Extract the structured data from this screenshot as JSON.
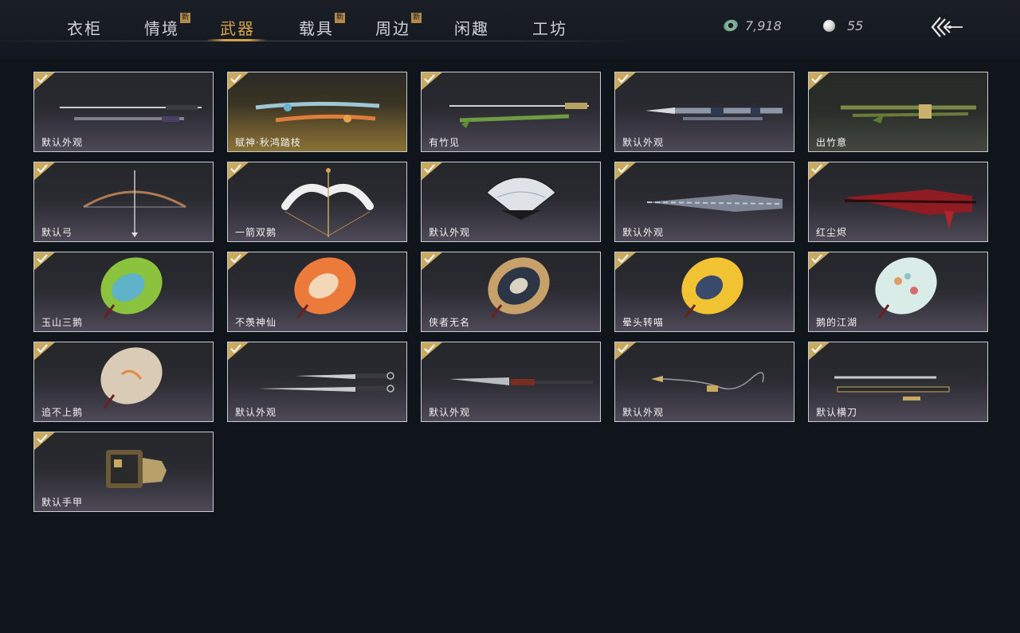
{
  "tabs": [
    {
      "label": "衣柜",
      "new": false
    },
    {
      "label": "情境",
      "new": true
    },
    {
      "label": "武器",
      "new": false,
      "active": true
    },
    {
      "label": "载具",
      "new": true
    },
    {
      "label": "周边",
      "new": true
    },
    {
      "label": "闲趣",
      "new": false
    },
    {
      "label": "工坊",
      "new": false
    }
  ],
  "new_badge_label": "新",
  "currency": {
    "jade_amount": "7,918",
    "pearl_amount": "55"
  },
  "items": [
    {
      "name": "默认外观",
      "art": "sword-icon"
    },
    {
      "name": "赋神·秋鸿踏枝",
      "art": "ornate-sword-icon"
    },
    {
      "name": "有竹见",
      "art": "bamboo-sword-icon"
    },
    {
      "name": "默认外观",
      "art": "spear-icon"
    },
    {
      "name": "出竹意",
      "art": "bamboo-spear-icon"
    },
    {
      "name": "默认弓",
      "art": "bow-icon"
    },
    {
      "name": "一箭双鹅",
      "art": "goose-bow-icon"
    },
    {
      "name": "默认外观",
      "art": "fan-icon"
    },
    {
      "name": "默认外观",
      "art": "closed-umbrella-icon"
    },
    {
      "name": "红尘烬",
      "art": "red-umbrella-icon"
    },
    {
      "name": "玉山三鹅",
      "art": "green-umbrella-icon"
    },
    {
      "name": "不羡神仙",
      "art": "orange-umbrella-icon"
    },
    {
      "name": "侠者无名",
      "art": "brown-umbrella-icon"
    },
    {
      "name": "晕头转喵",
      "art": "yellow-umbrella-icon"
    },
    {
      "name": "鹅的江湖",
      "art": "white-umbrella-icon"
    },
    {
      "name": "追不上鹅",
      "art": "beige-umbrella-icon"
    },
    {
      "name": "默认外观",
      "art": "dual-blades-icon"
    },
    {
      "name": "默认外观",
      "art": "glaive-icon"
    },
    {
      "name": "默认外观",
      "art": "rope-dart-icon"
    },
    {
      "name": "默认横刀",
      "art": "hengdao-icon"
    },
    {
      "name": "默认手甲",
      "art": "gauntlet-icon"
    }
  ],
  "colors": {
    "accent": "#d7a24e",
    "background": "#10141b",
    "card_border": "#c8cbd0"
  }
}
